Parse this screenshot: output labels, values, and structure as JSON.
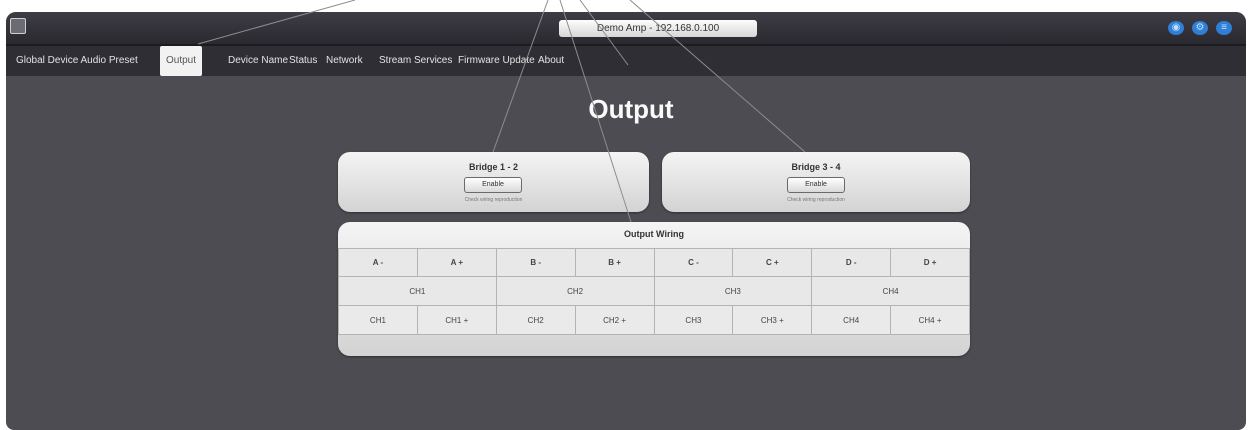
{
  "window": {
    "title": "Demo Amp - 192.168.0.100"
  },
  "colors": {
    "background": "#4d4c52",
    "accent": "#2f7fd6",
    "positive": "#e02020"
  },
  "titlebar_icons": [
    "wifi-icon",
    "settings-icon",
    "menu-icon"
  ],
  "tabs": [
    {
      "label": "Global Device Audio Preset"
    },
    {
      "label": "Output"
    },
    {
      "label": "Device Name"
    },
    {
      "label": "Status"
    },
    {
      "label": "Network"
    },
    {
      "label": "Stream Services"
    },
    {
      "label": "Firmware Update"
    },
    {
      "label": "About"
    }
  ],
  "active_tab": "Output",
  "page": {
    "title": "Output"
  },
  "bridges": [
    {
      "title": "Bridge 1 - 2",
      "button": "Enable",
      "note": "Check wiring reproduction"
    },
    {
      "title": "Bridge 3 - 4",
      "button": "Enable",
      "note": "Check wiring reproduction"
    }
  ],
  "wiring": {
    "title": "Output Wiring",
    "terminals": [
      "A -",
      "A +",
      "B -",
      "B +",
      "C -",
      "C +",
      "D -",
      "D +"
    ],
    "channels": [
      "CH1",
      "CH2",
      "CH3",
      "CH4"
    ],
    "signals": [
      "CH1",
      "CH1 +",
      "CH2",
      "CH2 +",
      "CH3",
      "CH3 +",
      "CH4",
      "CH4 +"
    ]
  }
}
